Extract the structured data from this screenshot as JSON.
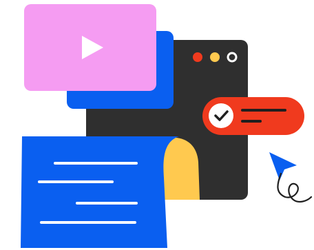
{
  "illustration": {
    "icons": {
      "video": "play-icon",
      "task": "checkmark-icon",
      "pointer": "cursor-arrow-icon"
    },
    "window_controls": [
      "close-dot",
      "minimize-dot",
      "maximize-dot"
    ],
    "colors": {
      "pink": "#f59cf2",
      "blue": "#0a5ff0",
      "dark": "#2f2f2f",
      "red": "#f03a1e",
      "yellow": "#ffc94f",
      "white": "#ffffff",
      "ink": "#1f1f1f"
    }
  }
}
